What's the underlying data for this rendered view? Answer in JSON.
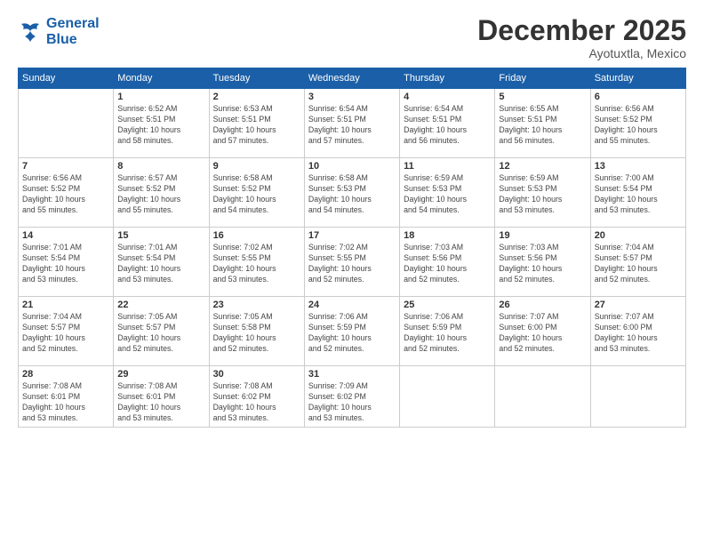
{
  "logo": {
    "line1": "General",
    "line2": "Blue"
  },
  "title": "December 2025",
  "location": "Ayotuxtla, Mexico",
  "weekdays": [
    "Sunday",
    "Monday",
    "Tuesday",
    "Wednesday",
    "Thursday",
    "Friday",
    "Saturday"
  ],
  "weeks": [
    [
      {
        "day": "",
        "text": ""
      },
      {
        "day": "1",
        "text": "Sunrise: 6:52 AM\nSunset: 5:51 PM\nDaylight: 10 hours\nand 58 minutes."
      },
      {
        "day": "2",
        "text": "Sunrise: 6:53 AM\nSunset: 5:51 PM\nDaylight: 10 hours\nand 57 minutes."
      },
      {
        "day": "3",
        "text": "Sunrise: 6:54 AM\nSunset: 5:51 PM\nDaylight: 10 hours\nand 57 minutes."
      },
      {
        "day": "4",
        "text": "Sunrise: 6:54 AM\nSunset: 5:51 PM\nDaylight: 10 hours\nand 56 minutes."
      },
      {
        "day": "5",
        "text": "Sunrise: 6:55 AM\nSunset: 5:51 PM\nDaylight: 10 hours\nand 56 minutes."
      },
      {
        "day": "6",
        "text": "Sunrise: 6:56 AM\nSunset: 5:52 PM\nDaylight: 10 hours\nand 55 minutes."
      }
    ],
    [
      {
        "day": "7",
        "text": "Sunrise: 6:56 AM\nSunset: 5:52 PM\nDaylight: 10 hours\nand 55 minutes."
      },
      {
        "day": "8",
        "text": "Sunrise: 6:57 AM\nSunset: 5:52 PM\nDaylight: 10 hours\nand 55 minutes."
      },
      {
        "day": "9",
        "text": "Sunrise: 6:58 AM\nSunset: 5:52 PM\nDaylight: 10 hours\nand 54 minutes."
      },
      {
        "day": "10",
        "text": "Sunrise: 6:58 AM\nSunset: 5:53 PM\nDaylight: 10 hours\nand 54 minutes."
      },
      {
        "day": "11",
        "text": "Sunrise: 6:59 AM\nSunset: 5:53 PM\nDaylight: 10 hours\nand 54 minutes."
      },
      {
        "day": "12",
        "text": "Sunrise: 6:59 AM\nSunset: 5:53 PM\nDaylight: 10 hours\nand 53 minutes."
      },
      {
        "day": "13",
        "text": "Sunrise: 7:00 AM\nSunset: 5:54 PM\nDaylight: 10 hours\nand 53 minutes."
      }
    ],
    [
      {
        "day": "14",
        "text": "Sunrise: 7:01 AM\nSunset: 5:54 PM\nDaylight: 10 hours\nand 53 minutes."
      },
      {
        "day": "15",
        "text": "Sunrise: 7:01 AM\nSunset: 5:54 PM\nDaylight: 10 hours\nand 53 minutes."
      },
      {
        "day": "16",
        "text": "Sunrise: 7:02 AM\nSunset: 5:55 PM\nDaylight: 10 hours\nand 53 minutes."
      },
      {
        "day": "17",
        "text": "Sunrise: 7:02 AM\nSunset: 5:55 PM\nDaylight: 10 hours\nand 52 minutes."
      },
      {
        "day": "18",
        "text": "Sunrise: 7:03 AM\nSunset: 5:56 PM\nDaylight: 10 hours\nand 52 minutes."
      },
      {
        "day": "19",
        "text": "Sunrise: 7:03 AM\nSunset: 5:56 PM\nDaylight: 10 hours\nand 52 minutes."
      },
      {
        "day": "20",
        "text": "Sunrise: 7:04 AM\nSunset: 5:57 PM\nDaylight: 10 hours\nand 52 minutes."
      }
    ],
    [
      {
        "day": "21",
        "text": "Sunrise: 7:04 AM\nSunset: 5:57 PM\nDaylight: 10 hours\nand 52 minutes."
      },
      {
        "day": "22",
        "text": "Sunrise: 7:05 AM\nSunset: 5:57 PM\nDaylight: 10 hours\nand 52 minutes."
      },
      {
        "day": "23",
        "text": "Sunrise: 7:05 AM\nSunset: 5:58 PM\nDaylight: 10 hours\nand 52 minutes."
      },
      {
        "day": "24",
        "text": "Sunrise: 7:06 AM\nSunset: 5:59 PM\nDaylight: 10 hours\nand 52 minutes."
      },
      {
        "day": "25",
        "text": "Sunrise: 7:06 AM\nSunset: 5:59 PM\nDaylight: 10 hours\nand 52 minutes."
      },
      {
        "day": "26",
        "text": "Sunrise: 7:07 AM\nSunset: 6:00 PM\nDaylight: 10 hours\nand 52 minutes."
      },
      {
        "day": "27",
        "text": "Sunrise: 7:07 AM\nSunset: 6:00 PM\nDaylight: 10 hours\nand 53 minutes."
      }
    ],
    [
      {
        "day": "28",
        "text": "Sunrise: 7:08 AM\nSunset: 6:01 PM\nDaylight: 10 hours\nand 53 minutes."
      },
      {
        "day": "29",
        "text": "Sunrise: 7:08 AM\nSunset: 6:01 PM\nDaylight: 10 hours\nand 53 minutes."
      },
      {
        "day": "30",
        "text": "Sunrise: 7:08 AM\nSunset: 6:02 PM\nDaylight: 10 hours\nand 53 minutes."
      },
      {
        "day": "31",
        "text": "Sunrise: 7:09 AM\nSunset: 6:02 PM\nDaylight: 10 hours\nand 53 minutes."
      },
      {
        "day": "",
        "text": ""
      },
      {
        "day": "",
        "text": ""
      },
      {
        "day": "",
        "text": ""
      }
    ]
  ]
}
